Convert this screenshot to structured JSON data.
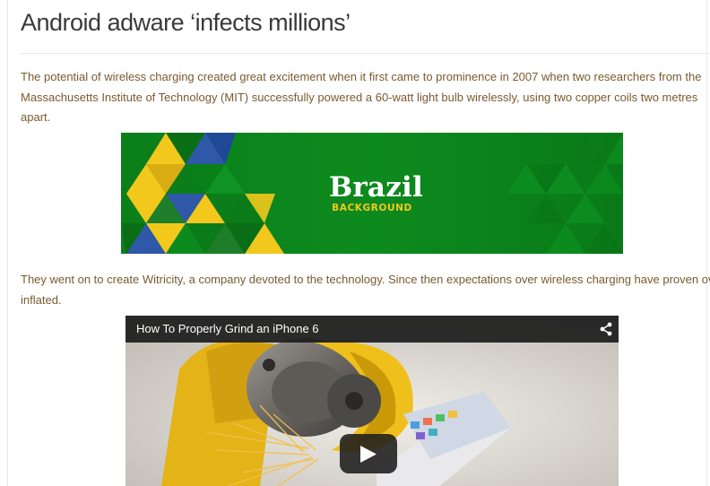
{
  "article": {
    "title": "Android adware ‘infects millions’",
    "paragraph1": "The potential of wireless charging created great excitement when it first came to prominence in 2007 when two researchers from the Massachusetts Institute of Technology (MIT) successfully powered a 60-watt light bulb wirelessly, using two copper coils two metres apart.",
    "paragraph2": "They went on to create Witricity, a company devoted to the technology. Since then expectations over wireless charging have proven over-inflated."
  },
  "banner": {
    "title": "Brazil",
    "subtitle": "BACKGROUND",
    "colors": {
      "green": "#0d8a1e",
      "yellow": "#f2c81d",
      "blue": "#2f58a8"
    }
  },
  "video": {
    "title": "How To Properly Grind an iPhone 6",
    "share_icon": "share-icon",
    "play_icon": "play-icon"
  }
}
